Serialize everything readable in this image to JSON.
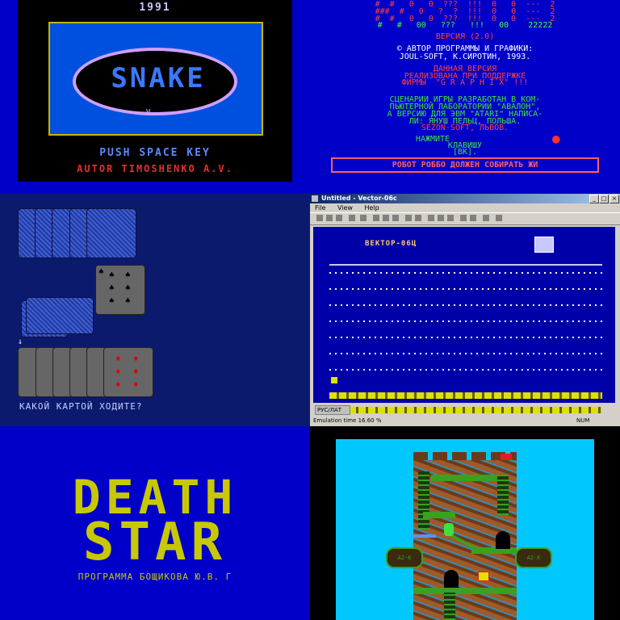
{
  "snake": {
    "year": "1991",
    "logo": "SNAKE",
    "push": "PUSH SPACE KEY",
    "autor": "AUTOR TIMOSHENKO A.V."
  },
  "robbo": {
    "score_lines": [
      "#  #   0   0  ???  !!!  0   0  ---  2",
      "###  #   0   ?  ?  !!!  0   0  ---  2",
      "#  #   0   0  ???  !!!  0   0  ---  2",
      "#   #   00   ???   !!!   00    22222"
    ],
    "version": "ВЕРСИЯ (2.0)",
    "author_line1": "© АВТОР ПРОГРАММЫ И ГРАФИКИ:",
    "author_line2": "JOUL-SOFT, К.СИРОТИН, 1993.",
    "release_line1": "ДАННАЯ ВЕРСИЯ",
    "release_line2": "РЕАЛИЗОВАНА ПРИ ПОДДЕРЖКЕ",
    "release_line3": "ФИРМЫ  \"G R A P H I X\" !!!",
    "scen_line1": "СЦЕНАРИИ ИГРЫ РАЗРАБОТАН В КОМ-",
    "scen_line2": "ПЬЮТЕРНОЙ ЛАБОРАТОРИИ \"АВАЛОН\",",
    "scen_line3": "А ВЕРСИЮ ДЛЯ ЭВМ \"ATARI\" НАПИСА-",
    "scen_line4": "ЛИ: ЯНУШ ПЕЛЬЦ, ПОЛЬША.",
    "scen_line5": "SEZON-SOFT, ЛЬВОВ.",
    "press_line1": "НАЖМИТЕ",
    "press_line2": "КЛАВИШУ",
    "press_line3": "[ВК].",
    "banner": "РОБОТ РОББО ДОЛЖЕН СОБИРАТЬ ЖИ"
  },
  "cards": {
    "question": "КАКОЙ КАРТОЙ ХОДИТЕ?"
  },
  "vector": {
    "window_title": "Untitled - Vector-06c",
    "menu": [
      "File",
      "View",
      "Help"
    ],
    "screen_title": "ВЕКТОР-06Ц",
    "status_left": "Emulation time 16.60 %",
    "status_right": "NUM",
    "taskbar_label": "РУС/ЛАТ"
  },
  "deathstar": {
    "title_line1": "DEATH",
    "title_line2": "STAR",
    "credit": "ПРОГРАММА БОЩИКОВА Ю.В. Г"
  },
  "tower": {
    "left_sign": "A2·K",
    "right_sign": "A2·K"
  },
  "colors": {
    "blue_bg": "#0000c8",
    "yellow": "#c8c800",
    "red": "#e03030",
    "green": "#3aa020"
  }
}
